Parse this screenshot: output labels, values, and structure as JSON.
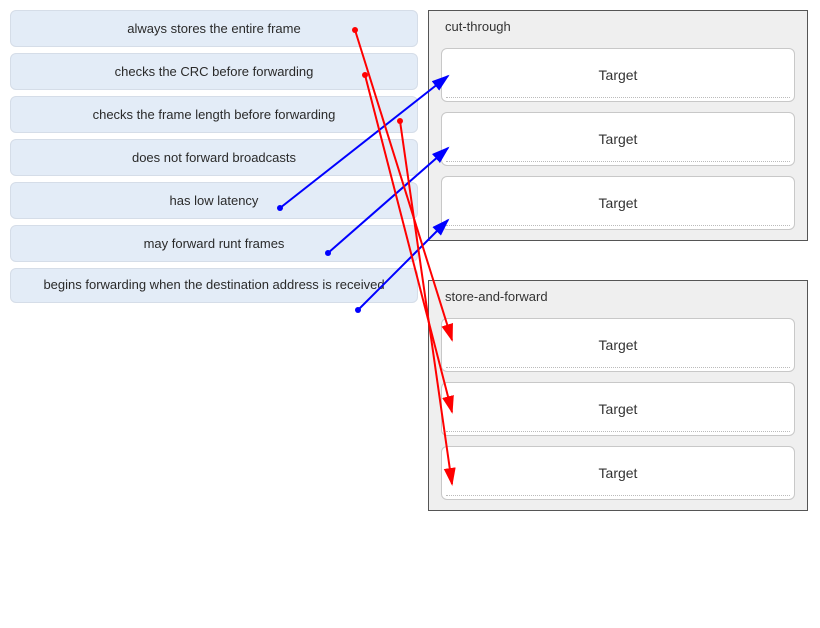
{
  "sources": [
    {
      "id": "s1",
      "label": "always stores the entire frame"
    },
    {
      "id": "s2",
      "label": "checks the CRC before forwarding"
    },
    {
      "id": "s3",
      "label": "checks the frame length before forwarding"
    },
    {
      "id": "s4",
      "label": "does not forward broadcasts"
    },
    {
      "id": "s5",
      "label": "has low latency"
    },
    {
      "id": "s6",
      "label": "may forward runt frames"
    },
    {
      "id": "s7",
      "label": "begins forwarding when the destination address is received"
    }
  ],
  "groups": [
    {
      "id": "g1",
      "title": "cut-through",
      "slots": [
        {
          "label": "Target"
        },
        {
          "label": "Target"
        },
        {
          "label": "Target"
        }
      ]
    },
    {
      "id": "g2",
      "title": "store-and-forward",
      "slots": [
        {
          "label": "Target"
        },
        {
          "label": "Target"
        },
        {
          "label": "Target"
        }
      ]
    }
  ],
  "connections": [
    {
      "from": "s5",
      "to_group": "g1",
      "to_slot": 0,
      "color": "blue"
    },
    {
      "from": "s6",
      "to_group": "g1",
      "to_slot": 1,
      "color": "blue"
    },
    {
      "from": "s7",
      "to_group": "g1",
      "to_slot": 2,
      "color": "blue"
    },
    {
      "from": "s1",
      "to_group": "g2",
      "to_slot": 0,
      "color": "red"
    },
    {
      "from": "s2",
      "to_group": "g2",
      "to_slot": 1,
      "color": "red"
    },
    {
      "from": "s3",
      "to_group": "g2",
      "to_slot": 2,
      "color": "red"
    }
  ],
  "colors": {
    "blue": "#0000ff",
    "red": "#ff0000"
  }
}
